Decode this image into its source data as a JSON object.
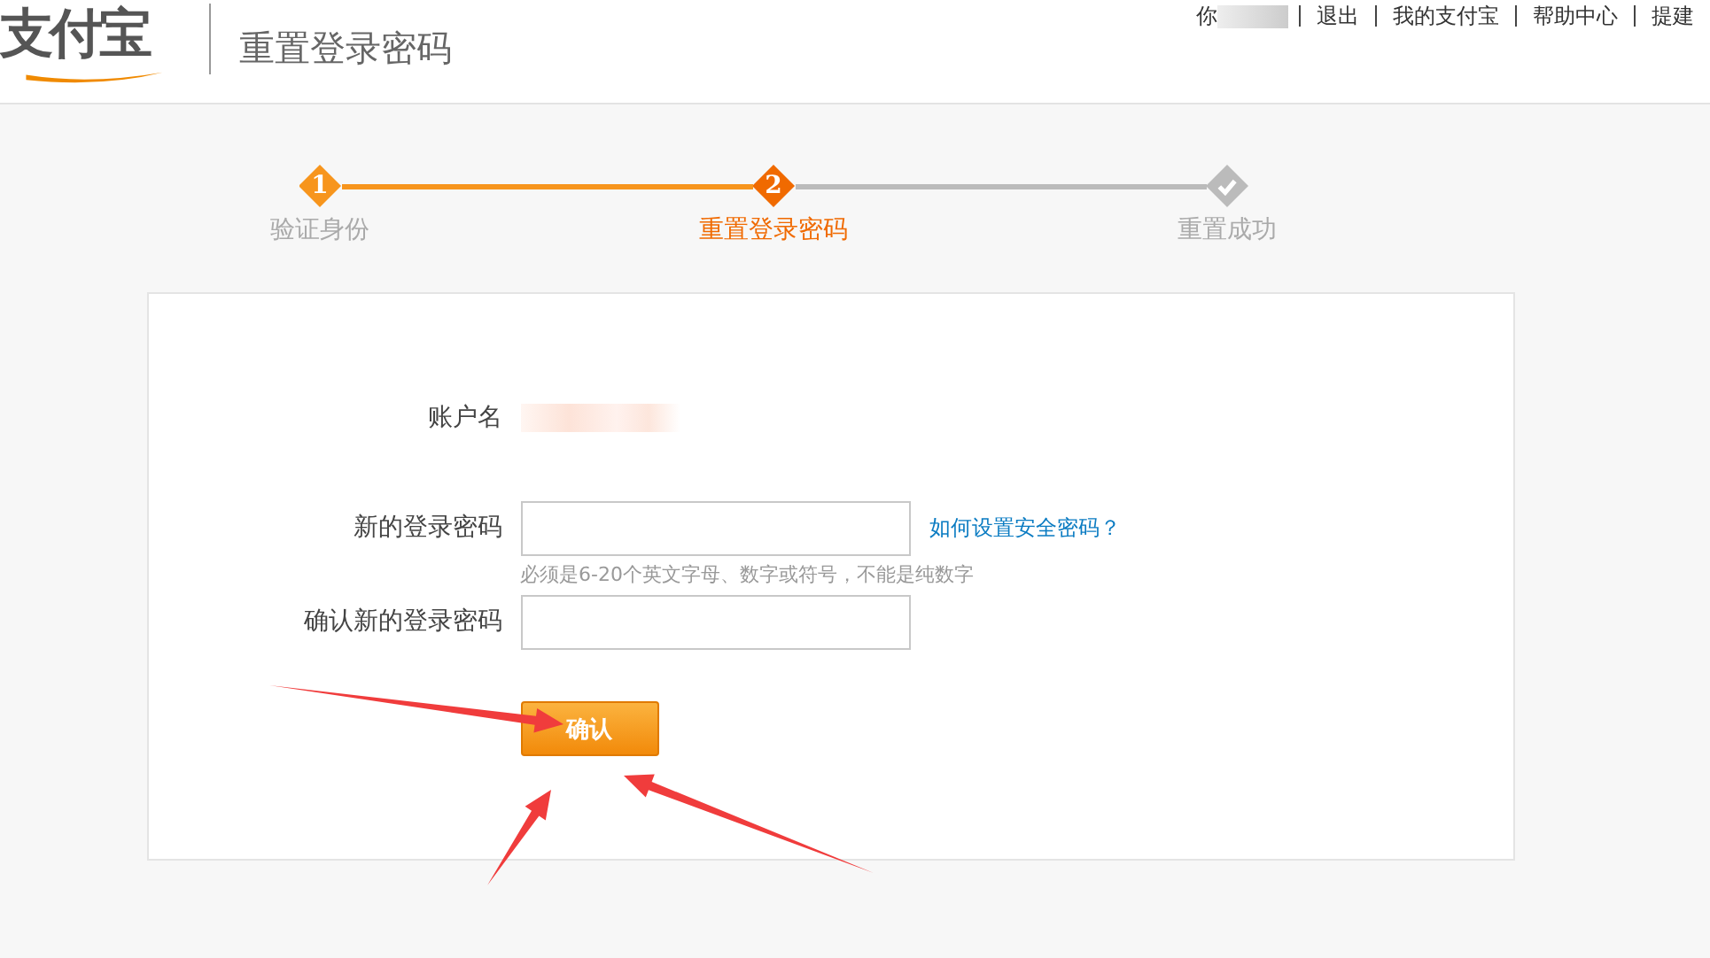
{
  "header": {
    "logo": "支付宝",
    "title": "重置登录密码",
    "nav": [
      {
        "label": "你",
        "redacted": true
      },
      {
        "label": "退出",
        "redacted": false
      },
      {
        "label": "我的支付宝",
        "redacted": false
      },
      {
        "label": "帮助中心",
        "redacted": false
      },
      {
        "label": "提建",
        "redacted": false
      }
    ]
  },
  "steps": [
    {
      "kind": "number",
      "number": "1",
      "label": "验证身份",
      "done": true,
      "current": false
    },
    {
      "kind": "number",
      "number": "2",
      "label": "重置登录密码",
      "done": false,
      "current": true
    },
    {
      "kind": "check",
      "label": "重置成功",
      "done": false,
      "current": false
    }
  ],
  "form": {
    "rows": [
      {
        "kind": "value",
        "label": "账户名",
        "redacted": true
      },
      {
        "kind": "input",
        "label": "新的登录密码",
        "link": "如何设置安全密码？",
        "hint": "必须是6-20个英文字母、数字或符号，不能是纯数字"
      },
      {
        "kind": "input",
        "label": "确认新的登录密码"
      }
    ],
    "submit": "确认"
  },
  "annotation": {
    "kind": "arrows"
  }
}
